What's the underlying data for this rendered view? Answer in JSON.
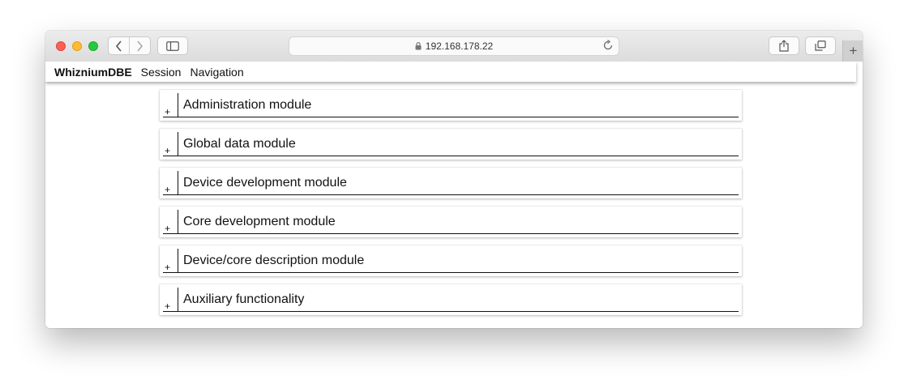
{
  "browser": {
    "url": "192.168.178.22",
    "new_tab_glyph": "+",
    "icons": [
      "back-icon",
      "forward-icon",
      "sidebar-icon",
      "lock-icon",
      "reload-icon",
      "share-icon",
      "tabs-icon"
    ]
  },
  "menubar": {
    "brand": "WhizniumDBE",
    "items": [
      "Session",
      "Navigation"
    ]
  },
  "modules": [
    {
      "expander": "+",
      "label": "Administration module"
    },
    {
      "expander": "+",
      "label": "Global data module"
    },
    {
      "expander": "+",
      "label": "Device development module"
    },
    {
      "expander": "+",
      "label": "Core development module"
    },
    {
      "expander": "+",
      "label": "Device/core description module"
    },
    {
      "expander": "+",
      "label": "Auxiliary functionality"
    }
  ]
}
